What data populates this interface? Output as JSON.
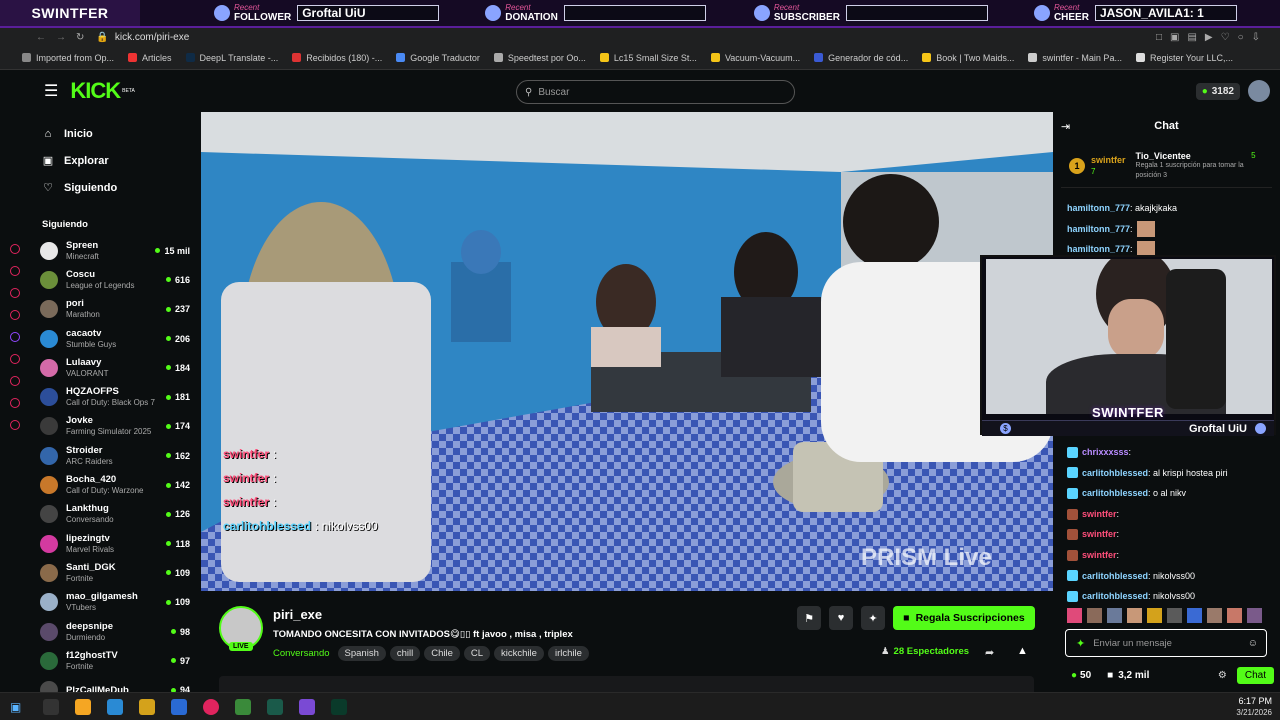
{
  "overlay": {
    "brand": "SWINTFER",
    "recent_label": "Recent",
    "slots": [
      {
        "label": "FOLLOWER",
        "value": "Groftal UiU",
        "icon": "user-icon"
      },
      {
        "label": "DONATION",
        "value": "",
        "icon": "dollar-icon"
      },
      {
        "label": "SUBSCRIBER",
        "value": "",
        "icon": "star-icon"
      },
      {
        "label": "CHEER",
        "value": "JASON_AVILA1: 1",
        "icon": "gem-icon"
      }
    ]
  },
  "browser": {
    "url": "kick.com/piri-exe",
    "bookmarks": [
      "Imported from Op...",
      "Articles",
      "DeepL Translate -...",
      "Recibidos (180) -...",
      "Google Traductor",
      "Speedtest por Oo...",
      "Lc15 Small Size St...",
      "Vacuum-Vacuum...",
      "Generador de cód...",
      "Book | Two Maids...",
      "swintfer - Main Pa...",
      "Register Your LLC,..."
    ]
  },
  "header": {
    "logo": "KICK",
    "logo_sup": "BETA",
    "search_placeholder": "Buscar",
    "kicks": "3182"
  },
  "nav": {
    "items": [
      {
        "label": "Inicio",
        "icon": "home-icon"
      },
      {
        "label": "Explorar",
        "icon": "compass-icon"
      },
      {
        "label": "Siguiendo",
        "icon": "heart-icon"
      }
    ],
    "following_title": "Siguiendo",
    "following": [
      {
        "name": "Spreen",
        "game": "Minecraft",
        "count": "15 mil",
        "color": "#e8e8e8"
      },
      {
        "name": "Coscu",
        "game": "League of Legends",
        "count": "616",
        "color": "#6b8f3a"
      },
      {
        "name": "pori",
        "game": "Marathon",
        "count": "237",
        "color": "#7a6a5a"
      },
      {
        "name": "cacaotv",
        "game": "Stumble Guys",
        "count": "206",
        "color": "#2a8ad4"
      },
      {
        "name": "Lulaavy",
        "game": "VALORANT",
        "count": "184",
        "color": "#d46aa8"
      },
      {
        "name": "HQZAOFPS",
        "game": "Call of Duty: Black Ops 7",
        "count": "181",
        "color": "#2c4e9a"
      },
      {
        "name": "Jovke",
        "game": "Farming Simulator 2025",
        "count": "174",
        "color": "#3a3a3a"
      },
      {
        "name": "Stroider",
        "game": "ARC Raiders",
        "count": "162",
        "color": "#3366aa"
      },
      {
        "name": "Bocha_420",
        "game": "Call of Duty: Warzone",
        "count": "142",
        "color": "#c8782a"
      },
      {
        "name": "Lankthug",
        "game": "Conversando",
        "count": "126",
        "color": "#444"
      },
      {
        "name": "lipezingtv",
        "game": "Marvel Rivals",
        "count": "118",
        "color": "#d43aa0"
      },
      {
        "name": "Santi_DGK",
        "game": "Fortnite",
        "count": "109",
        "color": "#8a6a4a"
      },
      {
        "name": "mao_gilgamesh",
        "game": "VTubers",
        "count": "109",
        "color": "#9ab0c8"
      },
      {
        "name": "deepsnipe",
        "game": "Durmiendo",
        "count": "98",
        "color": "#5a4a6a"
      },
      {
        "name": "f12ghostTV",
        "game": "Fortnite",
        "count": "97",
        "color": "#2a6a3a"
      },
      {
        "name": "PlzCallMeDub",
        "game": "",
        "count": "94",
        "color": "#4a4a4a"
      }
    ]
  },
  "video": {
    "watermark": "PRISM Live",
    "chat_overlay": [
      {
        "user": "swintfer",
        "text": ":"
      },
      {
        "user": "swintfer",
        "text": ":"
      },
      {
        "user": "swintfer",
        "text": ":"
      },
      {
        "user": "carlitohblessed",
        "text": ": nikolvss00"
      }
    ]
  },
  "stream": {
    "channel": "piri_exe",
    "live_badge": "LIVE",
    "title": "TOMANDO ONCESITA CON INVITADOS😋▯▯ ft javoo , misa , triplex",
    "category": "Conversando",
    "tags": [
      "Spanish",
      "chill",
      "Chile",
      "CL",
      "kickchile",
      "irlchile"
    ],
    "gift_button": "Regala Suscripciones",
    "viewers": "28 Espectadores"
  },
  "chat": {
    "title": "Chat",
    "pinned": {
      "rank": "1",
      "user": "swintfer",
      "count": "7",
      "gifter": "Tio_Vicentee",
      "gifter_count": "5",
      "promo": "Regala 1 suscripción para tomar la posición 3"
    },
    "messages_top": [
      {
        "user": "hamiltonn_777",
        "text": ": akajkjkaka"
      },
      {
        "user": "hamiltonn_777",
        "text": ":"
      },
      {
        "user": "hamiltonn_777",
        "text": ":"
      }
    ],
    "cam_name": "SWINTFER",
    "cam_follower": "Groftal UiU",
    "messages_bottom": [
      {
        "user": "chrixxxsss",
        "text": ":",
        "style": "purple"
      },
      {
        "user": "carlitohblessed",
        "text": ": al krispi hostea piri",
        "style": "blue"
      },
      {
        "user": "carlitohblessed",
        "text": ": o al nikv",
        "style": "blue"
      },
      {
        "user": "swintfer",
        "text": ":",
        "style": "pink"
      },
      {
        "user": "swintfer",
        "text": ":",
        "style": "pink"
      },
      {
        "user": "swintfer",
        "text": ":",
        "style": "pink"
      },
      {
        "user": "carlitohblessed",
        "text": ": nikolvss00",
        "style": "blue"
      },
      {
        "user": "carlitohblessed",
        "text": ": nikolvss00",
        "style": "blue"
      }
    ],
    "input_placeholder": "Enviar un mensaje",
    "points": "50",
    "channel_points": "3,2 mil",
    "send_button": "Chat"
  },
  "taskbar": {
    "time": "6:17 PM",
    "date": "3/21/2026"
  },
  "colors": {
    "kick_green": "#53fc18",
    "overlay_purple": "#5a1e9a"
  }
}
